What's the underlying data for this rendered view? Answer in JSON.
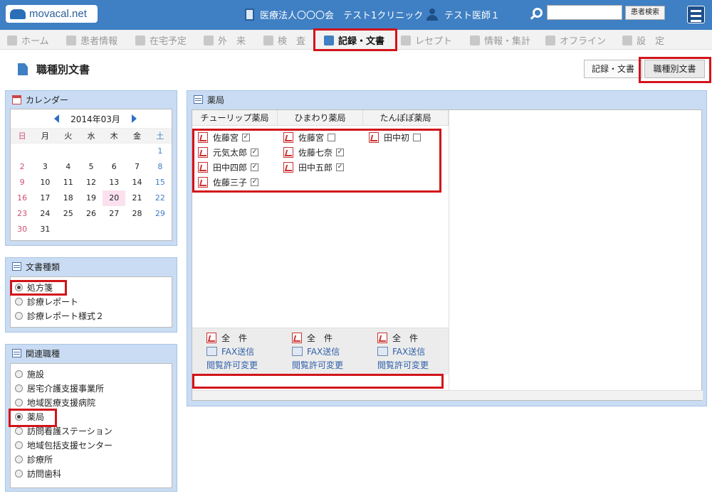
{
  "header": {
    "logo_text": "movacal.net",
    "clinic_label": "医療法人〇〇〇会　テスト1クリニック",
    "user_label": "テスト医師１",
    "search_placeholder": "",
    "search_button": "患者検索"
  },
  "nav": {
    "items": [
      {
        "label": "ホーム",
        "icon": "home-icon"
      },
      {
        "label": "患者情報",
        "icon": "patient-icon"
      },
      {
        "label": "在宅予定",
        "icon": "clock-icon"
      },
      {
        "label": "外　来",
        "icon": "outpatient-icon"
      },
      {
        "label": "検　査",
        "icon": "chart-icon"
      },
      {
        "label": "記録・文書",
        "icon": "document-icon",
        "active": true
      },
      {
        "label": "レセプト",
        "icon": "receipt-icon"
      },
      {
        "label": "情報・集計",
        "icon": "info-icon"
      },
      {
        "label": "オフライン",
        "icon": "offline-icon"
      },
      {
        "label": "設　定",
        "icon": "settings-icon"
      }
    ]
  },
  "page": {
    "title": "職種別文書",
    "tab_records": "記録・文書",
    "tab_by_profession": "職種別文書"
  },
  "calendar": {
    "title": "カレンダー",
    "month_label": "2014年03月",
    "weekdays": [
      "日",
      "月",
      "火",
      "水",
      "木",
      "金",
      "土"
    ],
    "weeks": [
      [
        "",
        "",
        "",
        "",
        "",
        "",
        "1"
      ],
      [
        "2",
        "3",
        "4",
        "5",
        "6",
        "7",
        "8"
      ],
      [
        "9",
        "10",
        "11",
        "12",
        "13",
        "14",
        "15"
      ],
      [
        "16",
        "17",
        "18",
        "19",
        "20",
        "21",
        "22"
      ],
      [
        "23",
        "24",
        "25",
        "26",
        "27",
        "28",
        "29"
      ],
      [
        "30",
        "31",
        "",
        "",
        "",
        "",
        ""
      ]
    ],
    "today": "20"
  },
  "doc_types": {
    "title": "文書種類",
    "options": [
      {
        "label": "処方箋",
        "selected": true
      },
      {
        "label": "診療レポート",
        "selected": false
      },
      {
        "label": "診療レポート様式２",
        "selected": false
      }
    ]
  },
  "professions": {
    "title": "関連職種",
    "options": [
      {
        "label": "施設",
        "selected": false
      },
      {
        "label": "居宅介護支援事業所",
        "selected": false
      },
      {
        "label": "地域医療支援病院",
        "selected": false
      },
      {
        "label": "薬局",
        "selected": true
      },
      {
        "label": "訪問看護ステーション",
        "selected": false
      },
      {
        "label": "地域包括支援センター",
        "selected": false
      },
      {
        "label": "診療所",
        "selected": false
      },
      {
        "label": "訪問歯科",
        "selected": false
      }
    ]
  },
  "pharmacy": {
    "title": "薬局",
    "columns": [
      {
        "name": "チューリップ薬局",
        "docs": [
          {
            "name": "佐藤宮",
            "checked": true
          },
          {
            "name": "元気太郎",
            "checked": true
          },
          {
            "name": "田中四郎",
            "checked": true
          },
          {
            "name": "佐藤三子",
            "checked": true
          }
        ],
        "all_label": "全　件",
        "fax_label": "FAX送信",
        "perm_label": "閲覧許可変更"
      },
      {
        "name": "ひまわり薬局",
        "docs": [
          {
            "name": "佐藤宮",
            "checked": false
          },
          {
            "name": "佐藤七奈",
            "checked": true
          },
          {
            "name": "田中五郎",
            "checked": true
          }
        ],
        "all_label": "全　件",
        "fax_label": "FAX送信",
        "perm_label": "閲覧許可変更"
      },
      {
        "name": "たんぽぽ薬局",
        "docs": [
          {
            "name": "田中初",
            "checked": false
          }
        ],
        "all_label": "全　件",
        "fax_label": "FAX送信",
        "perm_label": "閲覧許可変更"
      }
    ]
  },
  "colors": {
    "header_blue": "#3f7fc3",
    "panel_blue": "#c9dcf3",
    "highlight_red": "#d2141a"
  }
}
